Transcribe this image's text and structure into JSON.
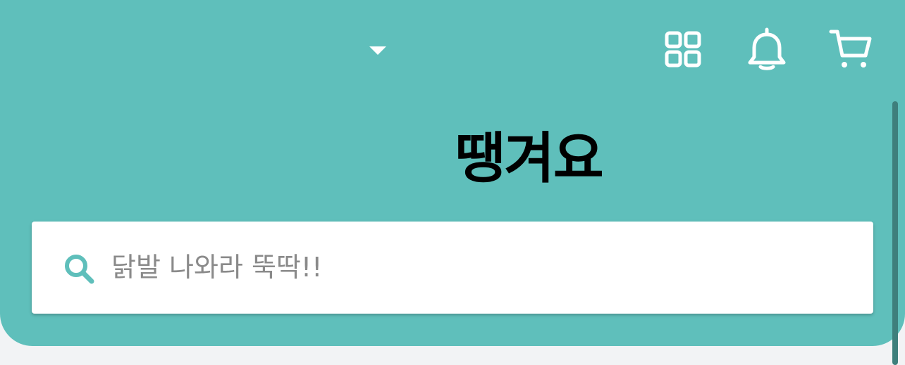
{
  "header": {
    "background_color": "#5fbfbb",
    "location_dropdown_icon": "caret-down-icon",
    "actions": [
      {
        "name": "apps",
        "icon": "grid-icon"
      },
      {
        "name": "notifications",
        "icon": "bell-icon"
      },
      {
        "name": "cart",
        "icon": "cart-icon"
      }
    ]
  },
  "brand": {
    "title": "땡겨요"
  },
  "search": {
    "icon": "search-icon",
    "icon_color": "#5fbfbb",
    "placeholder": "닭발 나와라 뚝딱!!"
  }
}
